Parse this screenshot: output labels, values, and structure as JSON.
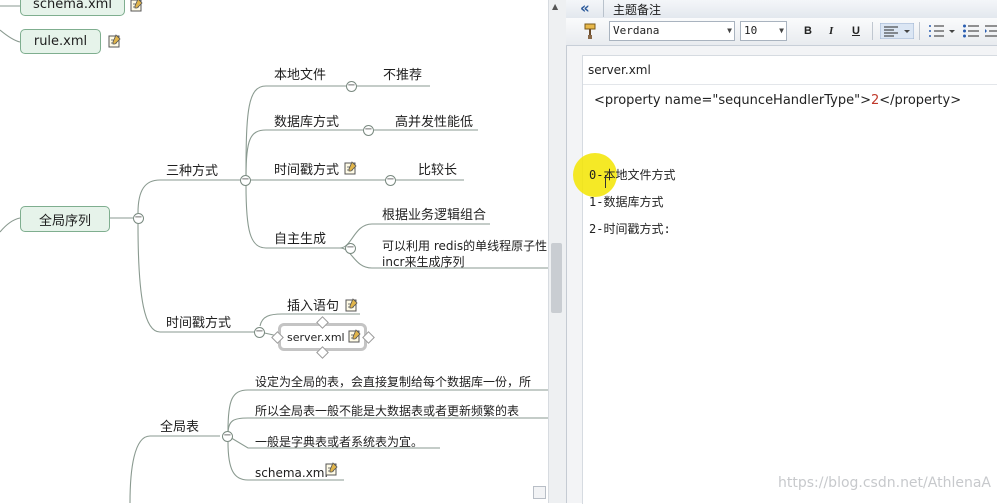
{
  "mindmap": {
    "top_nodes": {
      "schema_xml": "schema.xml",
      "rule_xml": "rule.xml"
    },
    "root": {
      "label": "全局序列"
    },
    "three_ways": {
      "label": "三种方式",
      "local_file": {
        "label": "本地文件",
        "note": "不推荐"
      },
      "database": {
        "label": "数据库方式",
        "note": "高并发性能低"
      },
      "timestamp": {
        "label": "时间戳方式",
        "note": "比较长"
      },
      "self_gen": {
        "label": "自主生成",
        "item1": "根据业务逻辑组合",
        "item2_line1": "可以利用 redis的单线程原子性",
        "item2_line2": "incr来生成序列"
      }
    },
    "timestamp_way": {
      "label": "时间戳方式",
      "insert_stmt": "插入语句",
      "server_xml": "server.xml"
    },
    "global_table": {
      "label": "全局表",
      "item1": "设定为全局的表，会直接复制给每个数据库一份，所",
      "item2": "所以全局表一般不能是大数据表或者更新频繁的表",
      "item3": "一般是字典表或者系统表为宜。",
      "schema_xml": "schema.xml"
    }
  },
  "notes_panel": {
    "collapse_glyph": "«",
    "title": "主题备注",
    "font_name": "Verdana",
    "font_size": "10",
    "bold": "B",
    "italic": "I",
    "underline": "U",
    "tab_label": "server.xml",
    "line_property_open": "<property name=\"sequnceHandlerType\">",
    "line_property_value": "2",
    "line_property_close": "</property>",
    "line_0": "0-本地文件方式",
    "line_1": "1-数据库方式",
    "line_2": "2-时间戳方式:"
  },
  "watermark": "https://blog.csdn.net/AthlenaA",
  "colors": {
    "node_fill": "#e6f3ea",
    "node_border": "#7fae8f",
    "highlight": "#f3e500",
    "value_red": "#c0392b"
  }
}
